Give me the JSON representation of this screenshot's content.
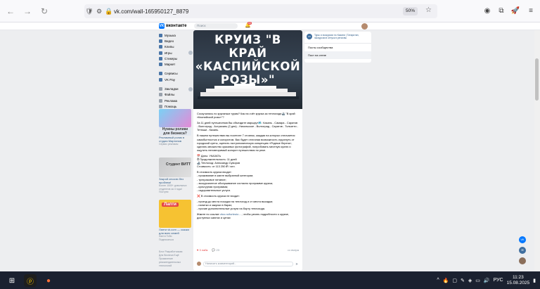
{
  "browser": {
    "url": "vk.com/wall-165950127_8879",
    "zoom": "50%"
  },
  "vk_header": {
    "logo_text": "вконтакте",
    "search_placeholder": "Поиск",
    "notifications_count": "68"
  },
  "sidebar": {
    "items": [
      {
        "label": "Музыка",
        "icon": "music-icon"
      },
      {
        "label": "Видео",
        "icon": "video-icon"
      },
      {
        "label": "Клипы",
        "icon": "clips-icon"
      },
      {
        "label": "Игры",
        "icon": "games-icon"
      },
      {
        "label": "Стикеры",
        "icon": "stickers-icon"
      },
      {
        "label": "Маркет",
        "icon": "market-icon"
      },
      {
        "label": "Сервисы",
        "icon": "services-icon"
      },
      {
        "label": "VK Pay",
        "icon": "pay-icon"
      },
      {
        "label": "Закладки",
        "icon": "bookmarks-icon"
      },
      {
        "label": "Файлы",
        "icon": "files-icon"
      },
      {
        "label": "Реклама",
        "icon": "ads-icon"
      },
      {
        "label": "Помощь",
        "icon": "help-icon"
      }
    ]
  },
  "ads": [
    {
      "title": "Нужны ролики для бизнеса?",
      "line1": "Рекламный ролик в",
      "line2": "студии Мартинов",
      "line3": "Сервис рекламы"
    },
    {
      "title": "Студент ВИТТ",
      "line1": "Закрой сессию без",
      "line2": "проблем!",
      "line3": "Более 1000+ довольных",
      "line4": "студентов за 4 года!",
      "line5": "Поступи"
    },
    {
      "title": "Лапти",
      "line1": "Лапти vk.com — сказки для всех семей",
      "line2": "Лапти Тоби",
      "line3": "Подписаться"
    }
  ],
  "footer_links": [
    "Блог",
    "Разработчикам",
    "Для бизнеса",
    "Ещё",
    "Проявление",
    "рекомендательных",
    "технологий"
  ],
  "post": {
    "image_title": "КРУИЗ \"В КРАЙ «КАСПИЙСКОЙ РОЗЫ»\"",
    "paragraphs": [
      "Соскучились по круизным турам? Как на счёт круиза за теплоходе🚢 \"В край «Каспийской розы»\"?",
      "За 11 дней путешествия Вы объездите маршрут🗺️: Казань - Самара - Саратов - Волгоград - Астрахань (2 дня) - Никольское - Волгоград - Саратов - Тольятти - Тетюши - Казань.",
      "В нашем путешествии вы посетите 7 стоянок, каждая на которых отличается самобытностью и колоритом. Вас будет отличная возможность отдохнуть от городской суеты, оценить гастрономическую концепцию «Родные берега», сделать множество красивых фотографий, попробовать местную кухню и ощутить неповторимый колорит путешествия по реке.",
      "📅 Даты: УКАЗАТЬ\n⏱ Продолжительность: 11 дней\n🚢 Теплоход: Александр Суворов\nСтоимость: от 113 250 ₽ / чел.",
      "В стоимость круиза входит:\n- проживание в каюте выбранной категории;\n- трехразовое питание;\n- экскурсионное обслуживание согласно программе круиза;\n- культурная программа;\n- оздоровительные услуги.",
      "❌ В стоимость круиза не входит:",
      "- проезд до места посадки на теплоход и от места высадки;\n- напитки и закуски в барах;\n- прочие дополнительные услуги на борту теплохода.",
      "Жмите по ссылке"
    ],
    "link_text": "vkcc.ru/turkruiz-...",
    "link_suffix": ", чтобы узнать подробности о круизе, доступных каютах и ценах",
    "likes": "3 лайк",
    "comments": "23",
    "views_label": "•••  вчера",
    "comment_placeholder": "Написать комментарий..."
  },
  "right_card": {
    "group_text": "Туры и экскурсии по Казани | Татарстан, экскурсии в отпуск в регионы",
    "avatar_label": "КП",
    "links": [
      "Посты сообщества",
      "Пост на стене"
    ]
  },
  "taskbar": {
    "time": "11:23",
    "date": "15.08.2025",
    "lang": "РУС"
  },
  "colors": {
    "vk_blue": "#0077ff",
    "link_blue": "#2a5885",
    "page_bg": "#edeef0",
    "taskbar_bg": "#1b2130"
  }
}
